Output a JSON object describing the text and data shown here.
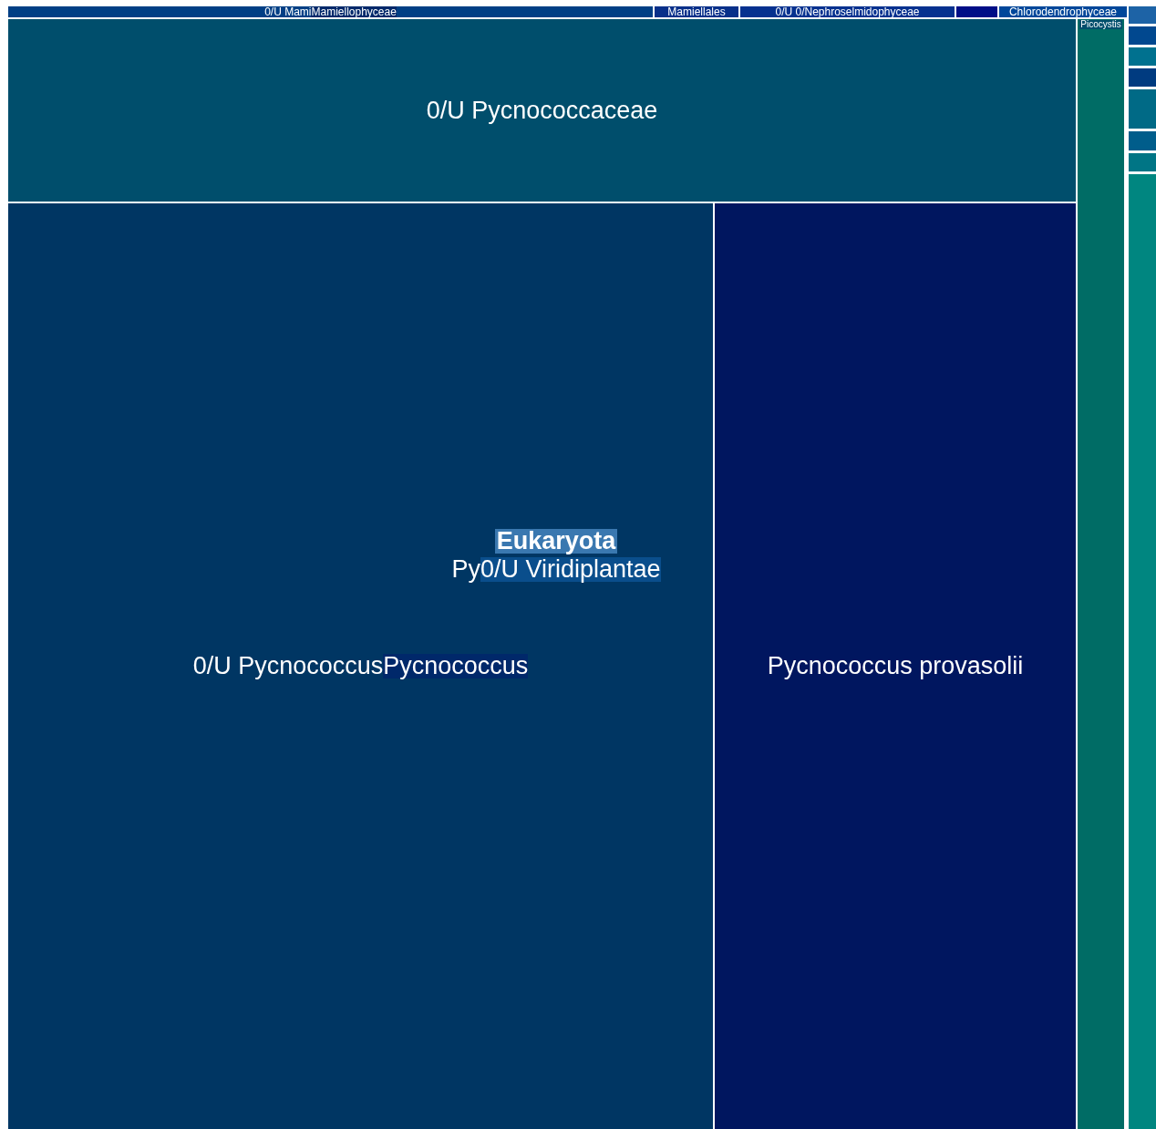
{
  "treemap": {
    "tiles": [
      {
        "labels": [
          "0/U Mami",
          "Mamiellophyceae"
        ],
        "color": "#003f85"
      },
      {
        "labels": [
          "Mamiellales"
        ],
        "color": "#08308a"
      },
      {
        "labels": [
          "0/U 0/Nephroselmidophyceae"
        ],
        "color": "#06318f"
      },
      {
        "color": "#000e87"
      },
      {
        "labels": [
          "Chlorodendrophyceae"
        ],
        "color": "#00479a"
      },
      {
        "labels": [
          "0/U Pycnococcaceae"
        ],
        "color": "#004e6c"
      },
      {
        "labels": [
          "Picocystis"
        ],
        "color": "#006c65"
      },
      {
        "labels": [
          "0/U Pycnococcus",
          "Pycnococcus"
        ],
        "color": "#003663"
      },
      {
        "labels": [
          "Pycnococcus provasolii"
        ],
        "color": "#00165f"
      },
      {
        "color": "#1d63a6"
      },
      {
        "color": "#01488f"
      },
      {
        "color": "#00718f"
      },
      {
        "color": "#003b80"
      },
      {
        "color": "#006a86"
      },
      {
        "color": "#005d8b"
      },
      {
        "color": "#007585"
      },
      {
        "color": "#008680"
      }
    ],
    "overlay_labels": [
      {
        "text": "Eukaryota",
        "kind": "root"
      },
      {
        "text": "Py",
        "kind": "plain"
      },
      {
        "text": "0/U Viridiplantae",
        "kind": "boxed"
      }
    ]
  }
}
